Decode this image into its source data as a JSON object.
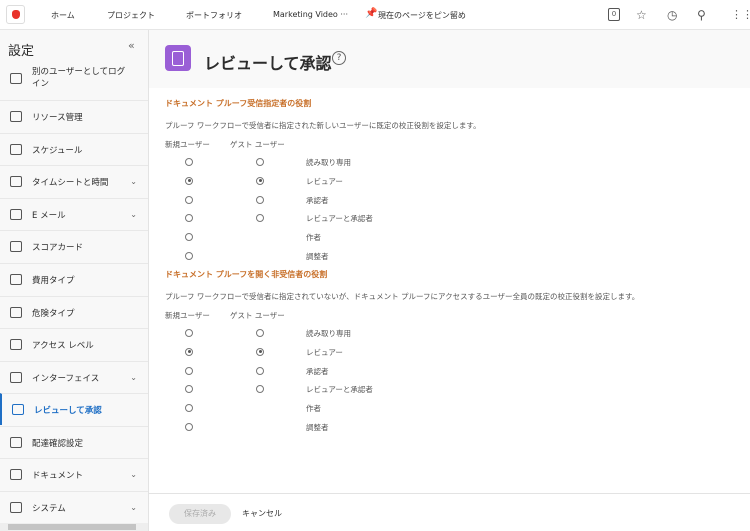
{
  "topbar": {
    "nav": [
      "ホーム",
      "プロジェクト",
      "ポートフォリオ",
      "Marketing Video ···",
      "現在のページをピン留め"
    ],
    "badge": "0",
    "icons": [
      "star-icon",
      "history-icon",
      "search-icon",
      "apps-grid-icon"
    ]
  },
  "sidebar": {
    "title": "設定",
    "collapse": "«",
    "items": [
      {
        "label": "別のユーザーとしてログイン",
        "icon": "login-icon"
      },
      {
        "label": "リソース管理",
        "icon": "resource-icon"
      },
      {
        "label": "スケジュール",
        "icon": "calendar-icon"
      },
      {
        "label": "タイムシートと時間",
        "icon": "timesheet-icon",
        "chevron": true
      },
      {
        "label": "E メール",
        "icon": "email-icon",
        "chevron": true
      },
      {
        "label": "スコアカード",
        "icon": "scorecard-icon"
      },
      {
        "label": "費用タイプ",
        "icon": "expense-icon"
      },
      {
        "label": "危険タイプ",
        "icon": "risk-icon"
      },
      {
        "label": "アクセス レベル",
        "icon": "lock-icon"
      },
      {
        "label": "インターフェイス",
        "icon": "interface-icon",
        "chevron": true
      },
      {
        "label": "レビューして承認",
        "icon": "review-icon",
        "active": true
      },
      {
        "label": "配達確認設定",
        "icon": "delivery-icon"
      },
      {
        "label": "ドキュメント",
        "icon": "document-icon",
        "chevron": true
      },
      {
        "label": "システム",
        "icon": "system-icon",
        "chevron": true
      }
    ]
  },
  "page": {
    "title": "レビューして承認",
    "help": "?"
  },
  "sections": [
    {
      "title": "ドキュメント プルーフ受信指定者の役割",
      "desc": "プルーフ ワークフローで受信者に指定された新しいユーザーに既定の校正役割を設定します。",
      "col_new": "新規ユーザー",
      "col_guest": "ゲスト ユーザー",
      "roles": [
        {
          "label": "読み取り専用",
          "new": false,
          "guest": false
        },
        {
          "label": "レビュアー",
          "new": true,
          "guest": true
        },
        {
          "label": "承認者",
          "new": false,
          "guest": false
        },
        {
          "label": "レビュアーと承認者",
          "new": false,
          "guest": false
        },
        {
          "label": "作者",
          "new": false,
          "guest": null
        },
        {
          "label": "調整者",
          "new": false,
          "guest": null
        }
      ]
    },
    {
      "title": "ドキュメント プルーフを開く非受信者の役割",
      "desc": "プルーフ ワークフローで受信者に指定されていないが、ドキュメント プルーフにアクセスするユーザー全員の既定の校正役割を設定します。",
      "col_new": "新規ユーザー",
      "col_guest": "ゲスト ユーザー",
      "roles": [
        {
          "label": "読み取り専用",
          "new": false,
          "guest": false
        },
        {
          "label": "レビュアー",
          "new": true,
          "guest": true
        },
        {
          "label": "承認者",
          "new": false,
          "guest": false
        },
        {
          "label": "レビュアーと承認者",
          "new": false,
          "guest": false
        },
        {
          "label": "作者",
          "new": false,
          "guest": null
        },
        {
          "label": "調整者",
          "new": false,
          "guest": null
        }
      ]
    }
  ],
  "footer": {
    "save": "保存済み",
    "cancel": "キャンセル"
  }
}
